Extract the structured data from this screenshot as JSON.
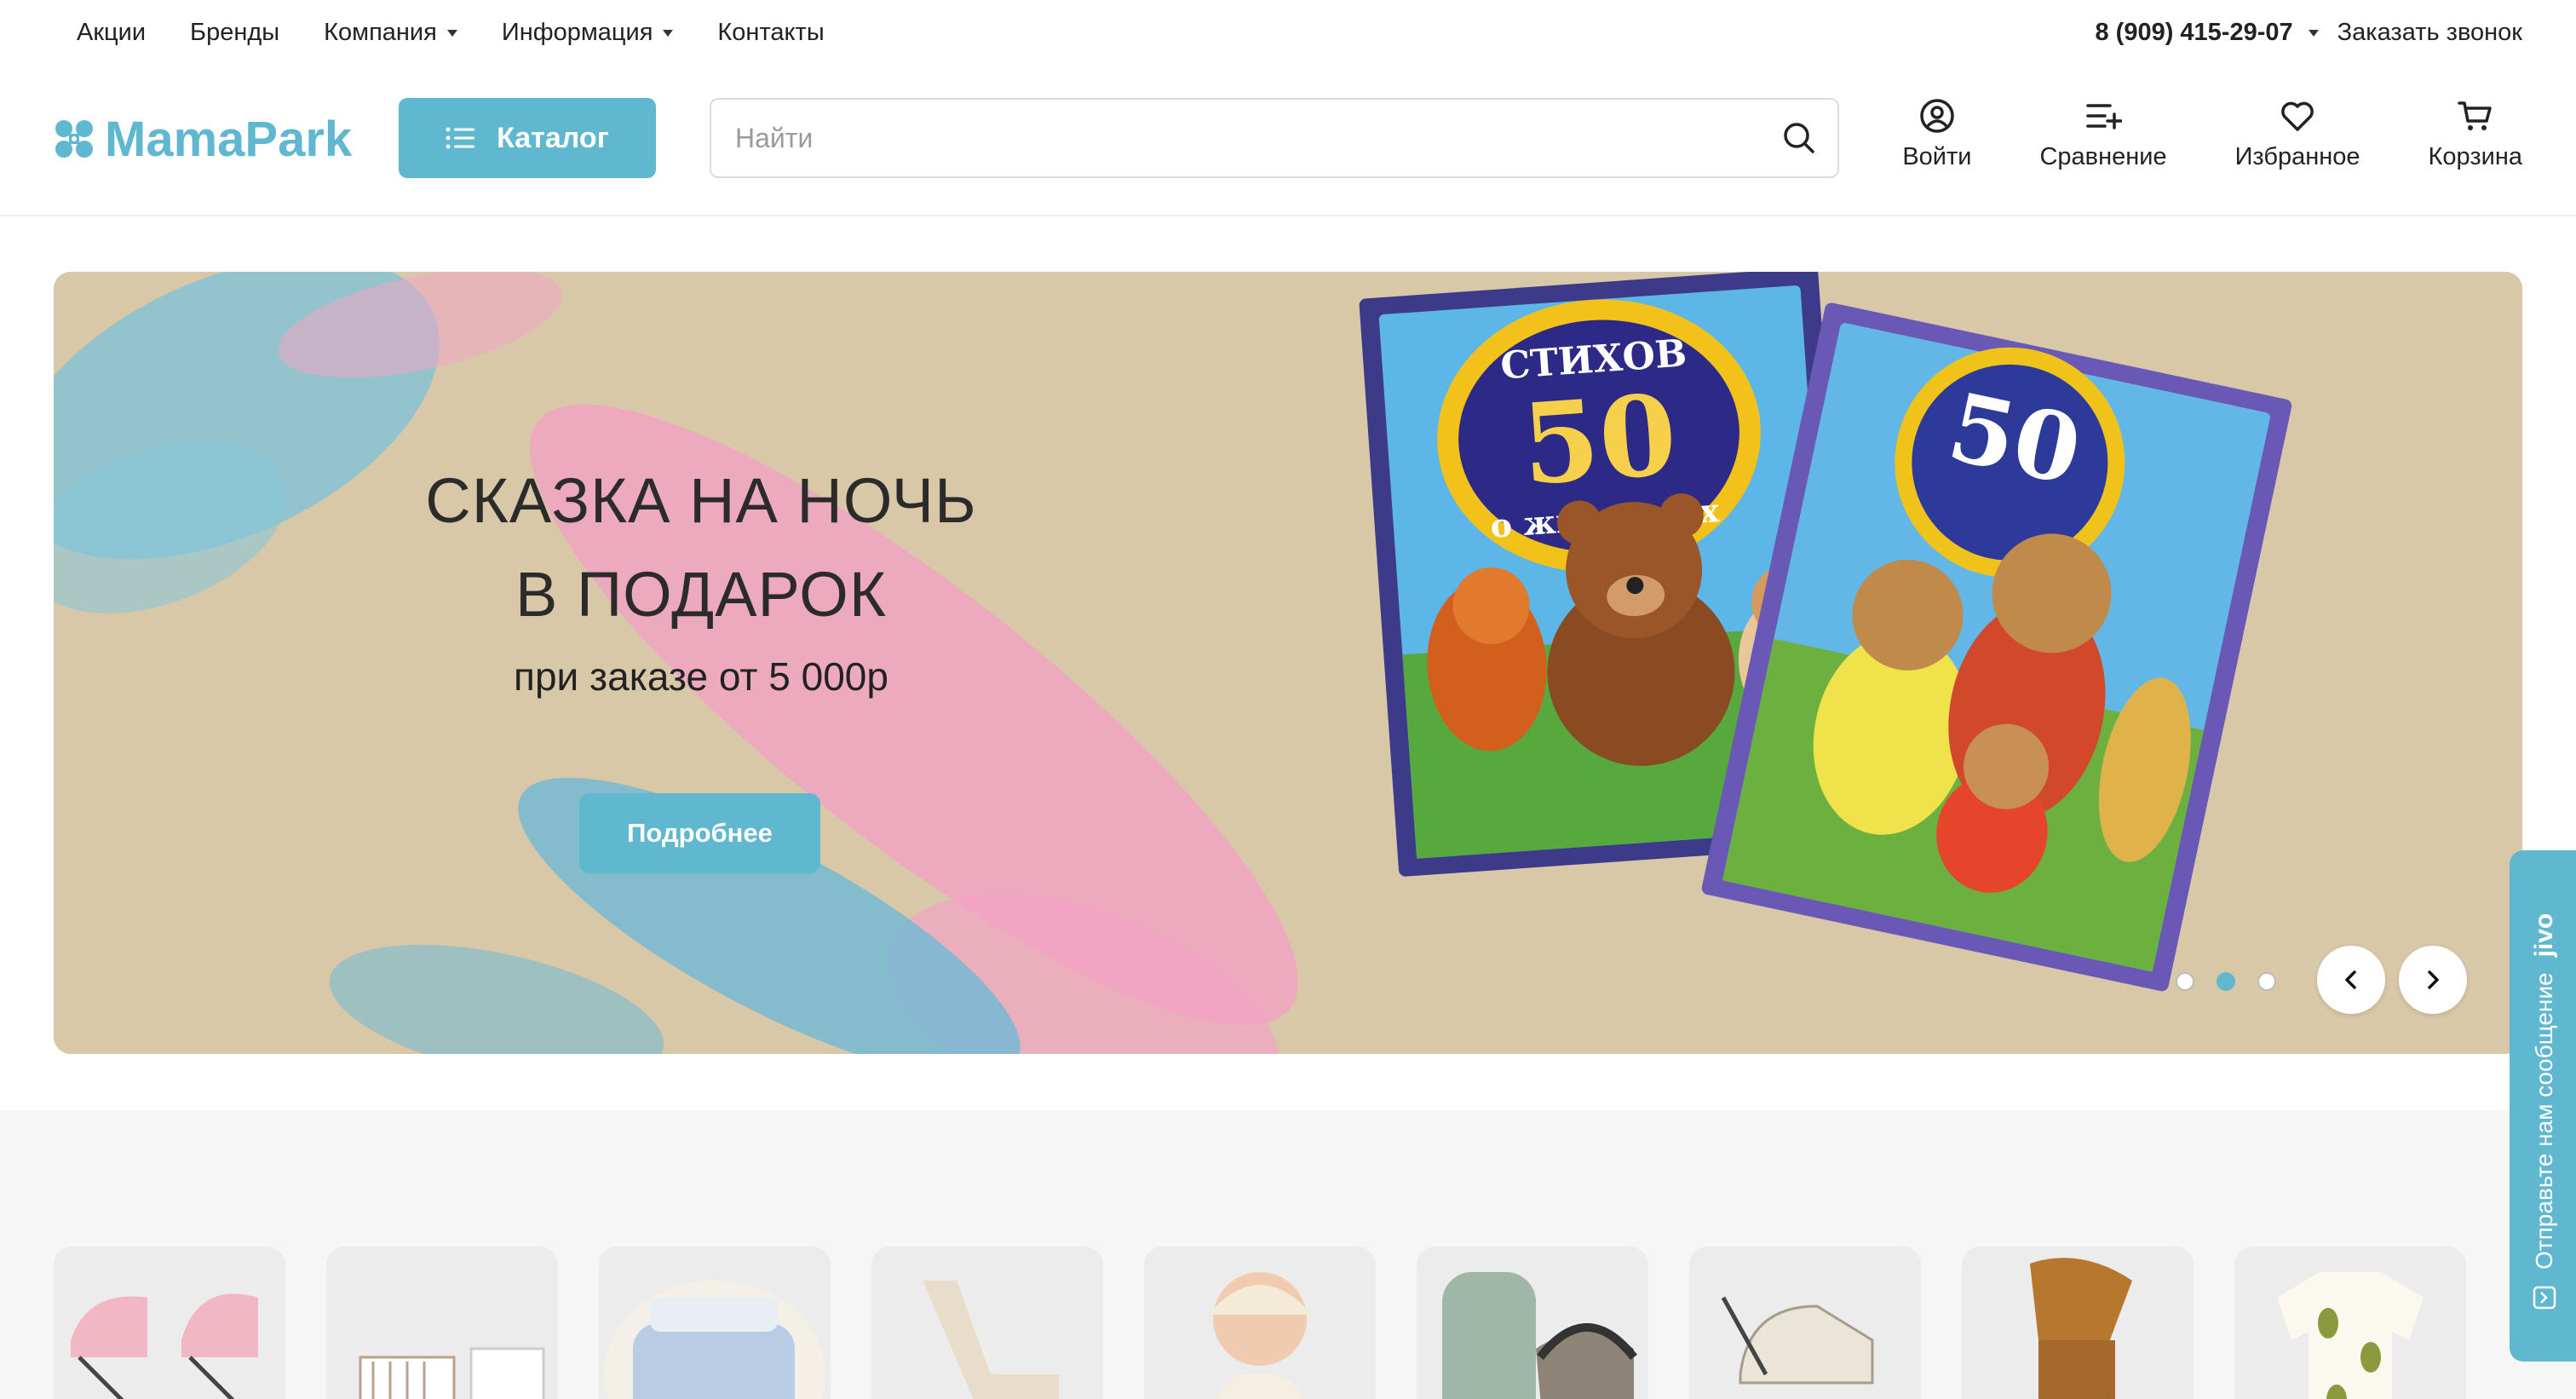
{
  "topnav": {
    "items": [
      {
        "label": "Акции",
        "dropdown": false
      },
      {
        "label": "Бренды",
        "dropdown": false
      },
      {
        "label": "Компания",
        "dropdown": true
      },
      {
        "label": "Информация",
        "dropdown": true
      },
      {
        "label": "Контакты",
        "dropdown": false
      }
    ],
    "phone": "8 (909) 415-29-07",
    "callback": "Заказать звонок"
  },
  "header": {
    "logo": "MamaPark",
    "catalog_label": "Каталог",
    "search_placeholder": "Найти",
    "actions": {
      "login": "Войти",
      "compare": "Сравнение",
      "favorites": "Избранное",
      "cart": "Корзина"
    }
  },
  "banner": {
    "title_line1": "СКАЗКА НА НОЧЬ",
    "title_line2": "В ПОДАРОК",
    "subtitle": "при заказе от 5 000р",
    "button": "Подробнее",
    "book1": {
      "top": "СТИХОВ",
      "number": "50",
      "bottom": "о животных"
    },
    "book2": {
      "number": "50"
    },
    "slides_total": 3,
    "active_slide": 2
  },
  "categories": [
    {
      "icon": "stroller-pink-icon"
    },
    {
      "icon": "crib-dresser-icon"
    },
    {
      "icon": "bedding-icon"
    },
    {
      "icon": "rocking-chair-icon"
    },
    {
      "icon": "baby-clothes-icon"
    },
    {
      "icon": "car-seat-icon"
    },
    {
      "icon": "pram-icon"
    },
    {
      "icon": "walking-stroller-icon"
    },
    {
      "icon": "bodysuit-icon"
    }
  ],
  "jivo": {
    "text": "Отправьте нам сообщение",
    "brand": "jivo"
  },
  "colors": {
    "accent": "#5fb8d0",
    "banner_bg": "#d7c6a6",
    "section_bg": "#f6f6f6"
  }
}
